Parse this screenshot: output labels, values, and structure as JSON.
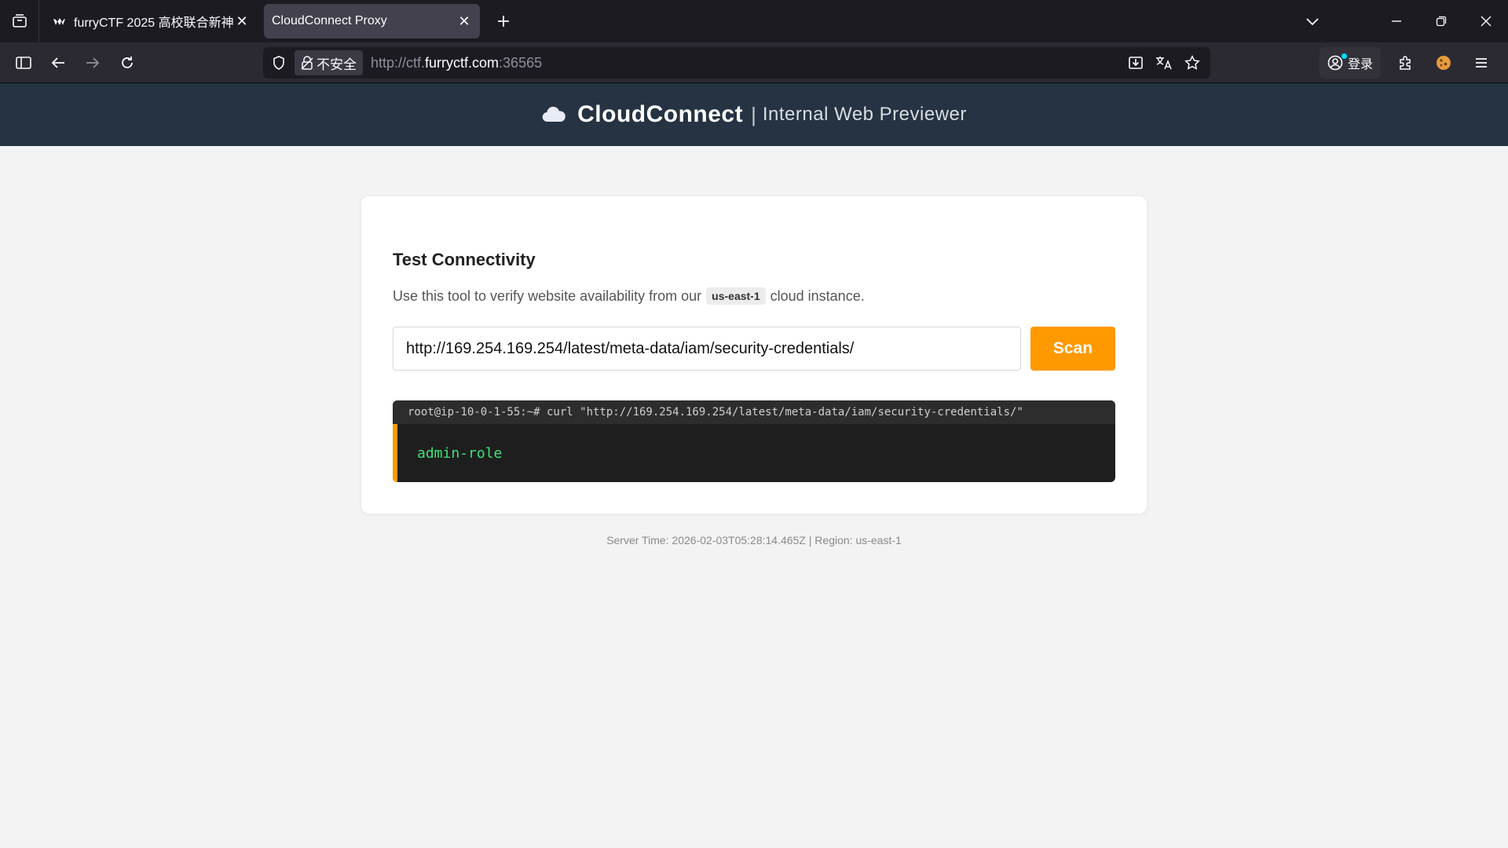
{
  "browser": {
    "tabs": [
      {
        "title": "furryCTF 2025 高校联合新神",
        "active": false
      },
      {
        "title": "CloudConnect Proxy",
        "active": true
      }
    ],
    "url_prefix": "http://ctf.",
    "url_host": "furryctf.com",
    "url_port": ":36565",
    "insecure_label": "不安全",
    "login_label": "登录"
  },
  "header": {
    "brand": "CloudConnect",
    "separator": "|",
    "tagline": "Internal Web Previewer"
  },
  "card": {
    "title": "Test Connectivity",
    "desc_before": "Use this tool to verify website availability from our",
    "region": "us-east-1",
    "desc_after": "cloud instance.",
    "input_value": "http://169.254.169.254/latest/meta-data/iam/security-credentials/",
    "scan_label": "Scan",
    "terminal_command": "root@ip-10-0-1-55:~# curl \"http://169.254.169.254/latest/meta-data/iam/security-credentials/\"",
    "terminal_output": "admin-role"
  },
  "footer": {
    "text": "Server Time: 2026-02-03T05:28:14.465Z | Region: us-east-1"
  },
  "colors": {
    "accent": "#ff9900",
    "header_bg": "#253342",
    "terminal_output": "#3ee27a"
  }
}
